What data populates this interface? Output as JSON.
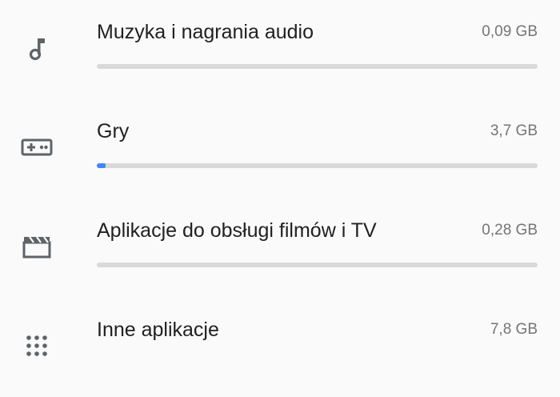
{
  "colors": {
    "accent": "#4285f4",
    "track": "#d9d9d9",
    "text": "#212121",
    "secondary": "#757575"
  },
  "categories": [
    {
      "label": "Muzyka i nagrania audio",
      "size": "0,09 GB",
      "icon": "music-note-icon",
      "usage_fraction": 0.0
    },
    {
      "label": "Gry",
      "size": "3,7 GB",
      "icon": "gamepad-icon",
      "usage_fraction": 0.02
    },
    {
      "label": "Aplikacje do obsługi filmów i TV",
      "size": "0,28 GB",
      "icon": "movie-clapperboard-icon",
      "usage_fraction": 0.0
    },
    {
      "label": "Inne aplikacje",
      "size": "7,8 GB",
      "icon": "apps-grid-icon",
      "usage_fraction": null
    }
  ]
}
